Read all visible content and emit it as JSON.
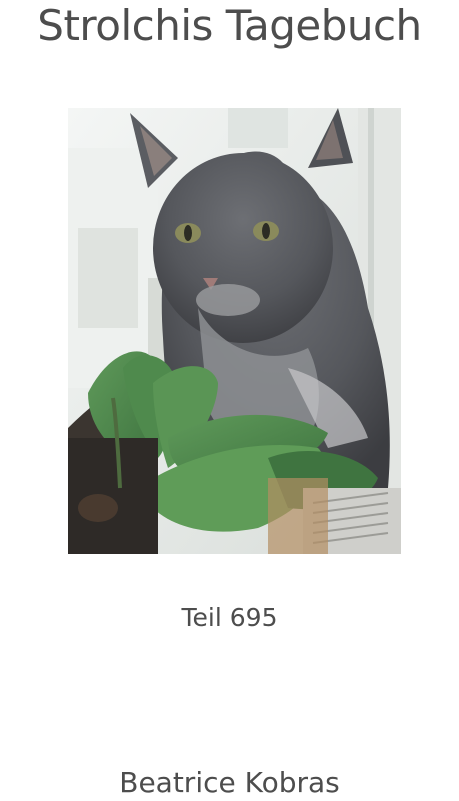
{
  "cover": {
    "title": "Strolchis Tagebuch",
    "subtitle": "Teil 695",
    "author": "Beatrice Kobras"
  },
  "colors": {
    "text": "#4d4d4d",
    "background": "#ffffff"
  }
}
